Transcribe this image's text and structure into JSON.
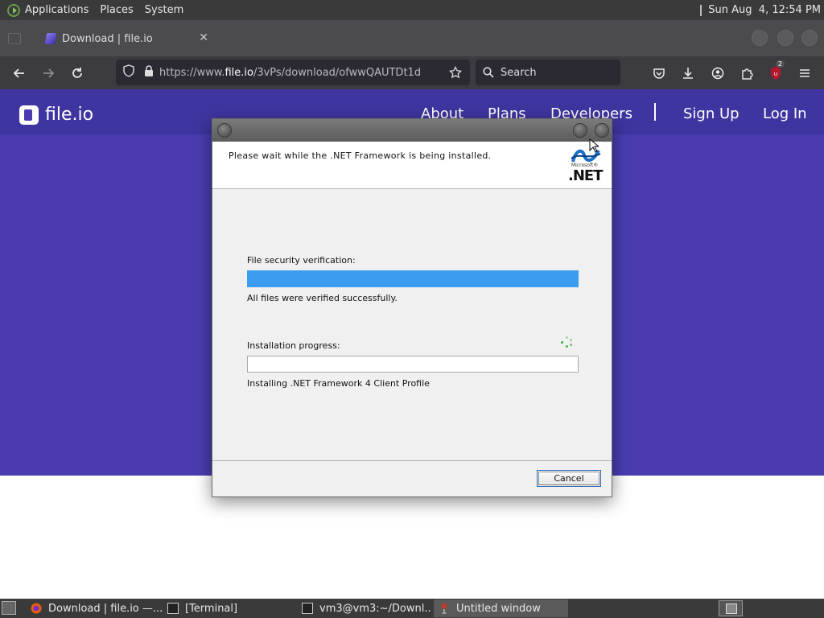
{
  "system_panel": {
    "menus": [
      "Applications",
      "Places",
      "System"
    ],
    "clock": "Sun Aug  4, 12:54 PM"
  },
  "browser": {
    "tab_title": "Download | file.io",
    "url_prefix": "https://www.",
    "url_domain": "file.io",
    "url_path": "/3vPs/download/ofwwQAUTDt1d",
    "search_placeholder": "Search",
    "extension_badge": "2"
  },
  "site": {
    "brand": "file.io",
    "nav": [
      "About",
      "Plans",
      "Developers",
      "Sign Up",
      "Log In"
    ]
  },
  "dialog": {
    "header_message": "Please wait while the .NET Framework is being installed.",
    "logo_small": "Microsoft®",
    "logo_big": ".NET",
    "verification_label": "File security verification:",
    "verification_progress": 1.0,
    "verification_status": "All files were verified successfully.",
    "install_label": "Installation progress:",
    "install_progress": 0.0,
    "install_status": "Installing .NET Framework 4 Client Profile",
    "cancel_label": "Cancel"
  },
  "taskbar": {
    "items": [
      "Download | file.io —...",
      "[Terminal]",
      "vm3@vm3:~/Downl...",
      "Untitled window"
    ]
  },
  "colors": {
    "panel": "#3a3a3a",
    "brand_purple": "#4a3cb0",
    "progress_blue": "#3b9cf0"
  }
}
